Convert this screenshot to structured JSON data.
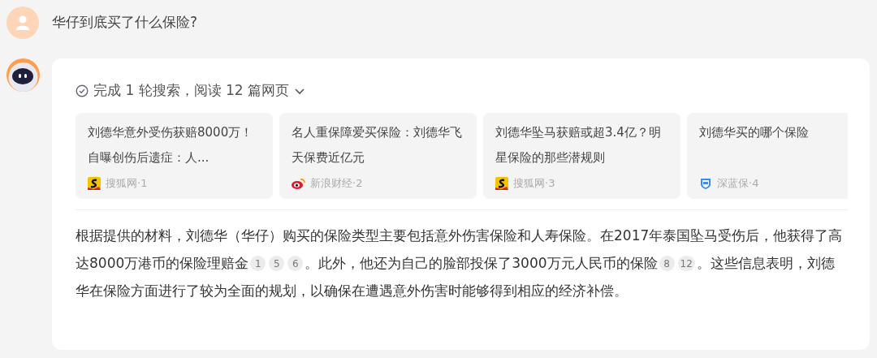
{
  "question": {
    "text": "华仔到底买了什么保险?"
  },
  "answer": {
    "search_summary": {
      "text": "完成 1 轮搜索，阅读 12 篇网页",
      "expanded": false
    },
    "sources": [
      {
        "title": "刘德华意外受伤获赔8000万！自曝创伤后遗症：人...",
        "source": "搜狐网·1",
        "kind": "sohu"
      },
      {
        "title": "名人重保障爱买保险：刘德华飞天保费近亿元",
        "source": "新浪财经·2",
        "kind": "sina"
      },
      {
        "title": "刘德华坠马获赔或超3.4亿？明星保险的那些潜规则",
        "source": "搜狐网·3",
        "kind": "sohu"
      },
      {
        "title": "刘德华买的哪个保险",
        "source": "深蓝保·4",
        "kind": "shield"
      }
    ],
    "paragraph": [
      {
        "kind": "text",
        "text": "根据提供的材料，刘德华（华仔）购买的保险类型主要包括意外伤害保险和人寿保险。在2017年泰国坠马受伤后，他获得了高达8000万港币的保险理赔金"
      },
      {
        "kind": "cite",
        "text": "1"
      },
      {
        "kind": "cite",
        "text": "5"
      },
      {
        "kind": "cite",
        "text": "6"
      },
      {
        "kind": "text",
        "text": "。此外，他还为自己的脸部投保了3000万元人民币的保险"
      },
      {
        "kind": "cite",
        "text": "8"
      },
      {
        "kind": "cite",
        "text": "12"
      },
      {
        "kind": "text",
        "text": "。这些信息表明，刘德华在保险方面进行了较为全面的规划，以确保在遭遇意外伤害时能够得到相应的经济补偿。"
      }
    ]
  }
}
